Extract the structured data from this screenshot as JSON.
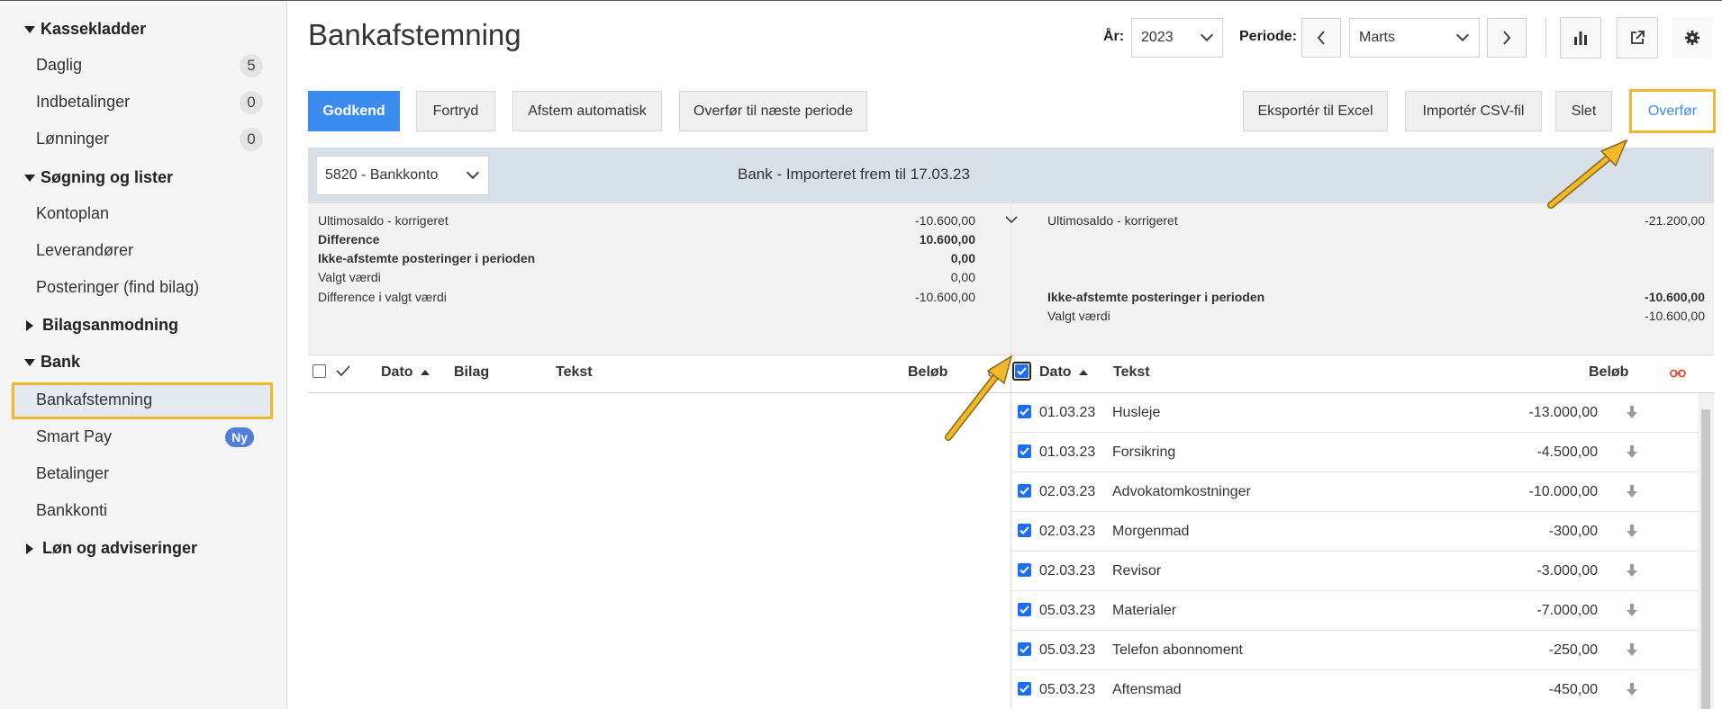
{
  "sidebar": {
    "sections": [
      {
        "label": "Kassekladder"
      },
      {
        "label": "Søgning og lister"
      },
      {
        "label": "Bilagsanmodning"
      },
      {
        "label": "Bank"
      },
      {
        "label": "Løn og adviseringer"
      }
    ],
    "items": {
      "daglig": {
        "label": "Daglig",
        "badge": "5"
      },
      "indbetalinger": {
        "label": "Indbetalinger",
        "badge": "0"
      },
      "lonninger": {
        "label": "Lønninger",
        "badge": "0"
      },
      "kontoplan": {
        "label": "Kontoplan"
      },
      "leverandorer": {
        "label": "Leverandører"
      },
      "posteringer": {
        "label": "Posteringer (find bilag)"
      },
      "bankafstemning": {
        "label": "Bankafstemning"
      },
      "smartpay": {
        "label": "Smart Pay",
        "badge": "Ny"
      },
      "betalinger": {
        "label": "Betalinger"
      },
      "bankkonti": {
        "label": "Bankkonti"
      }
    }
  },
  "header": {
    "title": "Bankafstemning",
    "year_label": "År:",
    "year_value": "2023",
    "period_label": "Periode:",
    "period_value": "Marts"
  },
  "toolbar": {
    "godkend": "Godkend",
    "fortryd": "Fortryd",
    "afstem": "Afstem automatisk",
    "overfor_naeste": "Overfør til næste periode",
    "eksporter": "Eksportér til Excel",
    "importer": "Importér CSV-fil",
    "slet": "Slet",
    "overfor": "Overfør"
  },
  "bank": {
    "account": "5820 - Bankkonto",
    "title": "Bank - Importeret frem til 17.03.23"
  },
  "summary_left": {
    "ultimo_label": "Ultimosaldo - korrigeret",
    "ultimo_value": "-10.600,00",
    "diff_label": "Difference",
    "diff_value": "10.600,00",
    "ikke_label": "Ikke-afstemte posteringer i perioden",
    "ikke_value": "0,00",
    "valgt_label": "Valgt værdi",
    "valgt_value": "0,00",
    "diffvalgt_label": "Difference i valgt værdi",
    "diffvalgt_value": "-10.600,00"
  },
  "summary_right": {
    "ultimo_label": "Ultimosaldo - korrigeret",
    "ultimo_value": "-21.200,00",
    "ikke_label": "Ikke-afstemte posteringer i perioden",
    "ikke_value": "-10.600,00",
    "valgt_label": "Valgt værdi",
    "valgt_value": "-10.600,00"
  },
  "left_table": {
    "headers": {
      "dato": "Dato",
      "bilag": "Bilag",
      "tekst": "Tekst",
      "belob": "Beløb"
    }
  },
  "right_table": {
    "headers": {
      "dato": "Dato",
      "tekst": "Tekst",
      "belob": "Beløb"
    },
    "rows": [
      {
        "date": "01.03.23",
        "text": "Husleje",
        "amount": "-13.000,00"
      },
      {
        "date": "01.03.23",
        "text": "Forsikring",
        "amount": "-4.500,00"
      },
      {
        "date": "02.03.23",
        "text": "Advokatomkostninger",
        "amount": "-10.000,00"
      },
      {
        "date": "02.03.23",
        "text": "Morgenmad",
        "amount": "-300,00"
      },
      {
        "date": "02.03.23",
        "text": "Revisor",
        "amount": "-3.000,00"
      },
      {
        "date": "05.03.23",
        "text": "Materialer",
        "amount": "-7.000,00"
      },
      {
        "date": "05.03.23",
        "text": "Telefon abonnoment",
        "amount": "-250,00"
      },
      {
        "date": "05.03.23",
        "text": "Aftensmad",
        "amount": "-450,00"
      }
    ]
  },
  "colors": {
    "primary": "#3c8cf0",
    "highlight": "#f0b82a",
    "link_icon": "#e04a3a",
    "badge_ny": "#4f7fd8"
  },
  "icons": [
    "chart-icon",
    "export-icon",
    "gear-icon",
    "chevron-left-icon",
    "chevron-right-icon",
    "link-icon",
    "download-arrow-icon"
  ]
}
